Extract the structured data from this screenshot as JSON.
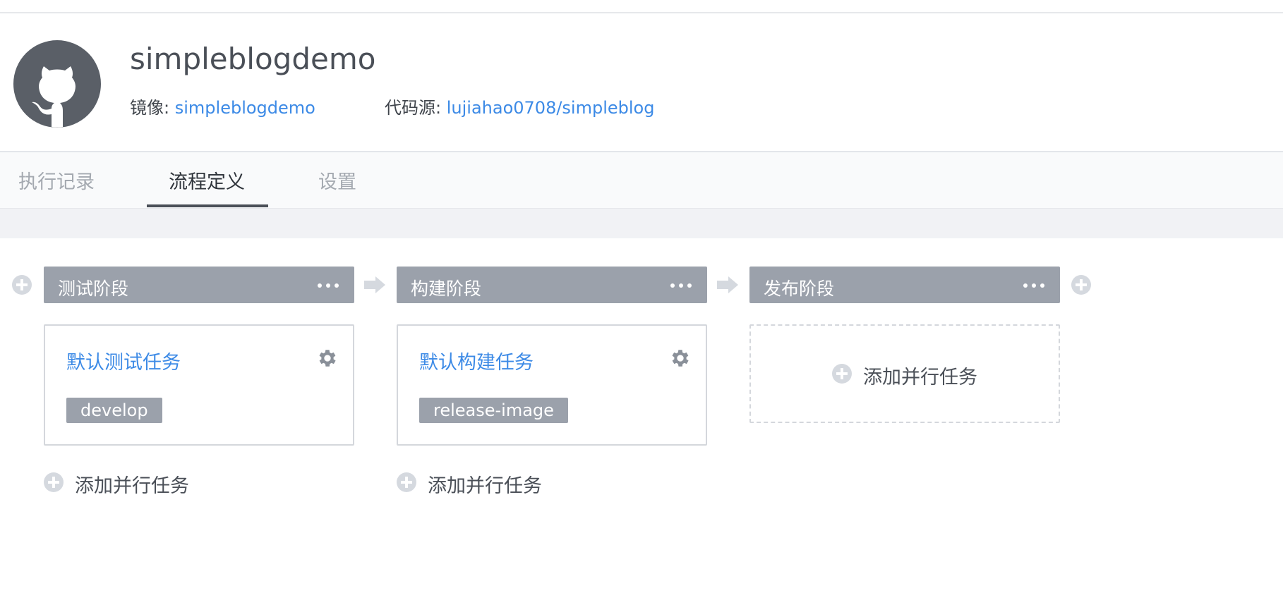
{
  "header": {
    "title": "simpleblogdemo",
    "image_label": "镜像:",
    "image_value": "simpleblogdemo",
    "source_label": "代码源:",
    "source_value": "lujiahao0708/simpleblog"
  },
  "tabs": [
    {
      "label": "执行记录",
      "active": false
    },
    {
      "label": "流程定义",
      "active": true
    },
    {
      "label": "设置",
      "active": false
    }
  ],
  "stages": [
    {
      "title": "测试阶段",
      "task": {
        "title": "默认测试任务",
        "tag": "develop"
      },
      "add_parallel_label": "添加并行任务"
    },
    {
      "title": "构建阶段",
      "task": {
        "title": "默认构建任务",
        "tag": "release-image"
      },
      "add_parallel_label": "添加并行任务"
    },
    {
      "title": "发布阶段",
      "empty_label": "添加并行任务"
    }
  ],
  "colors": {
    "link": "#3c8ae6",
    "stage_header": "#9ba1ab",
    "tag_bg": "#9ba1ab",
    "add_icon": "#d5d9df"
  },
  "icons": {
    "avatar": "github-octocat-icon",
    "stage_more": "more-horizontal-icon",
    "task_settings": "gear-icon",
    "add": "plus-circle-icon",
    "connector": "arrow-right-icon"
  }
}
